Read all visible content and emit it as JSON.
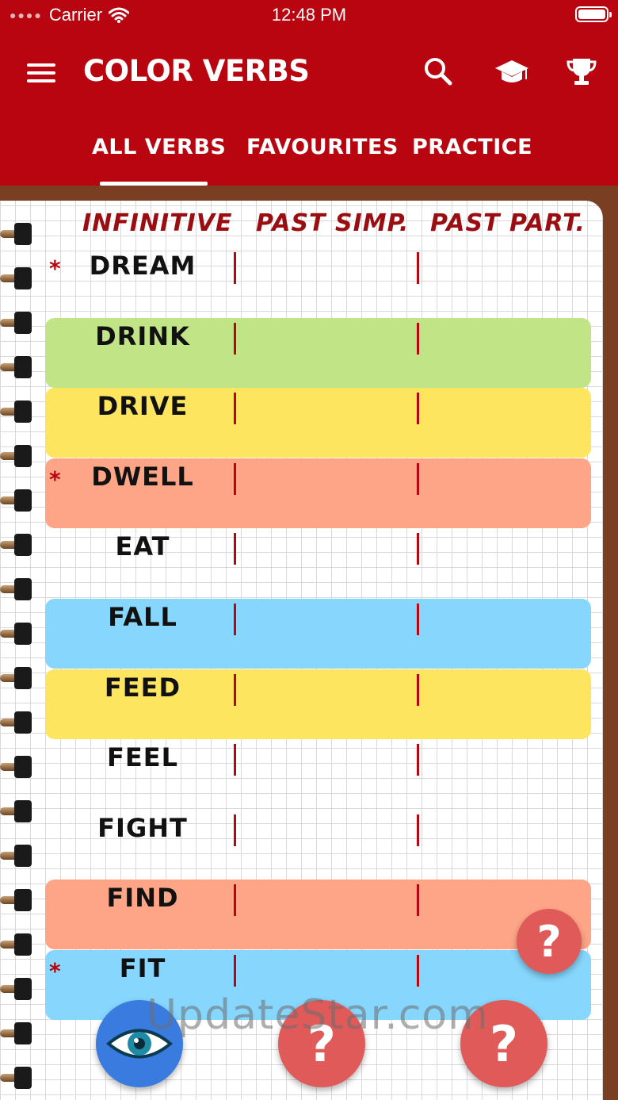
{
  "status": {
    "carrier": "Carrier",
    "time": "12:48 PM"
  },
  "header": {
    "title": "COLOR VERBS"
  },
  "tabs": [
    {
      "label": "ALL VERBS"
    },
    {
      "label": "FAVOURITES"
    },
    {
      "label": "PRACTICE"
    }
  ],
  "columns": {
    "infinitive": "INFINITIVE",
    "past_simple": "PAST SIMP.",
    "past_participle": "PAST PART."
  },
  "verbs": [
    {
      "text": "DREAM",
      "favourite": true,
      "color": ""
    },
    {
      "text": "DRINK",
      "favourite": false,
      "color": "#c1e486"
    },
    {
      "text": "DRIVE",
      "favourite": false,
      "color": "#fee55f"
    },
    {
      "text": "DWELL",
      "favourite": true,
      "color": "#fda586"
    },
    {
      "text": "EAT",
      "favourite": false,
      "color": ""
    },
    {
      "text": "FALL",
      "favourite": false,
      "color": "#86d6fd"
    },
    {
      "text": "FEED",
      "favourite": false,
      "color": "#fee55f"
    },
    {
      "text": "FEEL",
      "favourite": false,
      "color": ""
    },
    {
      "text": "FIGHT",
      "favourite": false,
      "color": ""
    },
    {
      "text": "FIND",
      "favourite": false,
      "color": "#fda586"
    },
    {
      "text": "FIT",
      "favourite": true,
      "color": "#86d6fd"
    }
  ],
  "fab": {
    "help_label": "?",
    "reveal_icon": "eye-icon"
  },
  "watermark": "UpdateStar.com",
  "colors": {
    "brand": "#b90510",
    "accent_red": "#e05a5a",
    "eye_blue": "#3a7be0"
  }
}
